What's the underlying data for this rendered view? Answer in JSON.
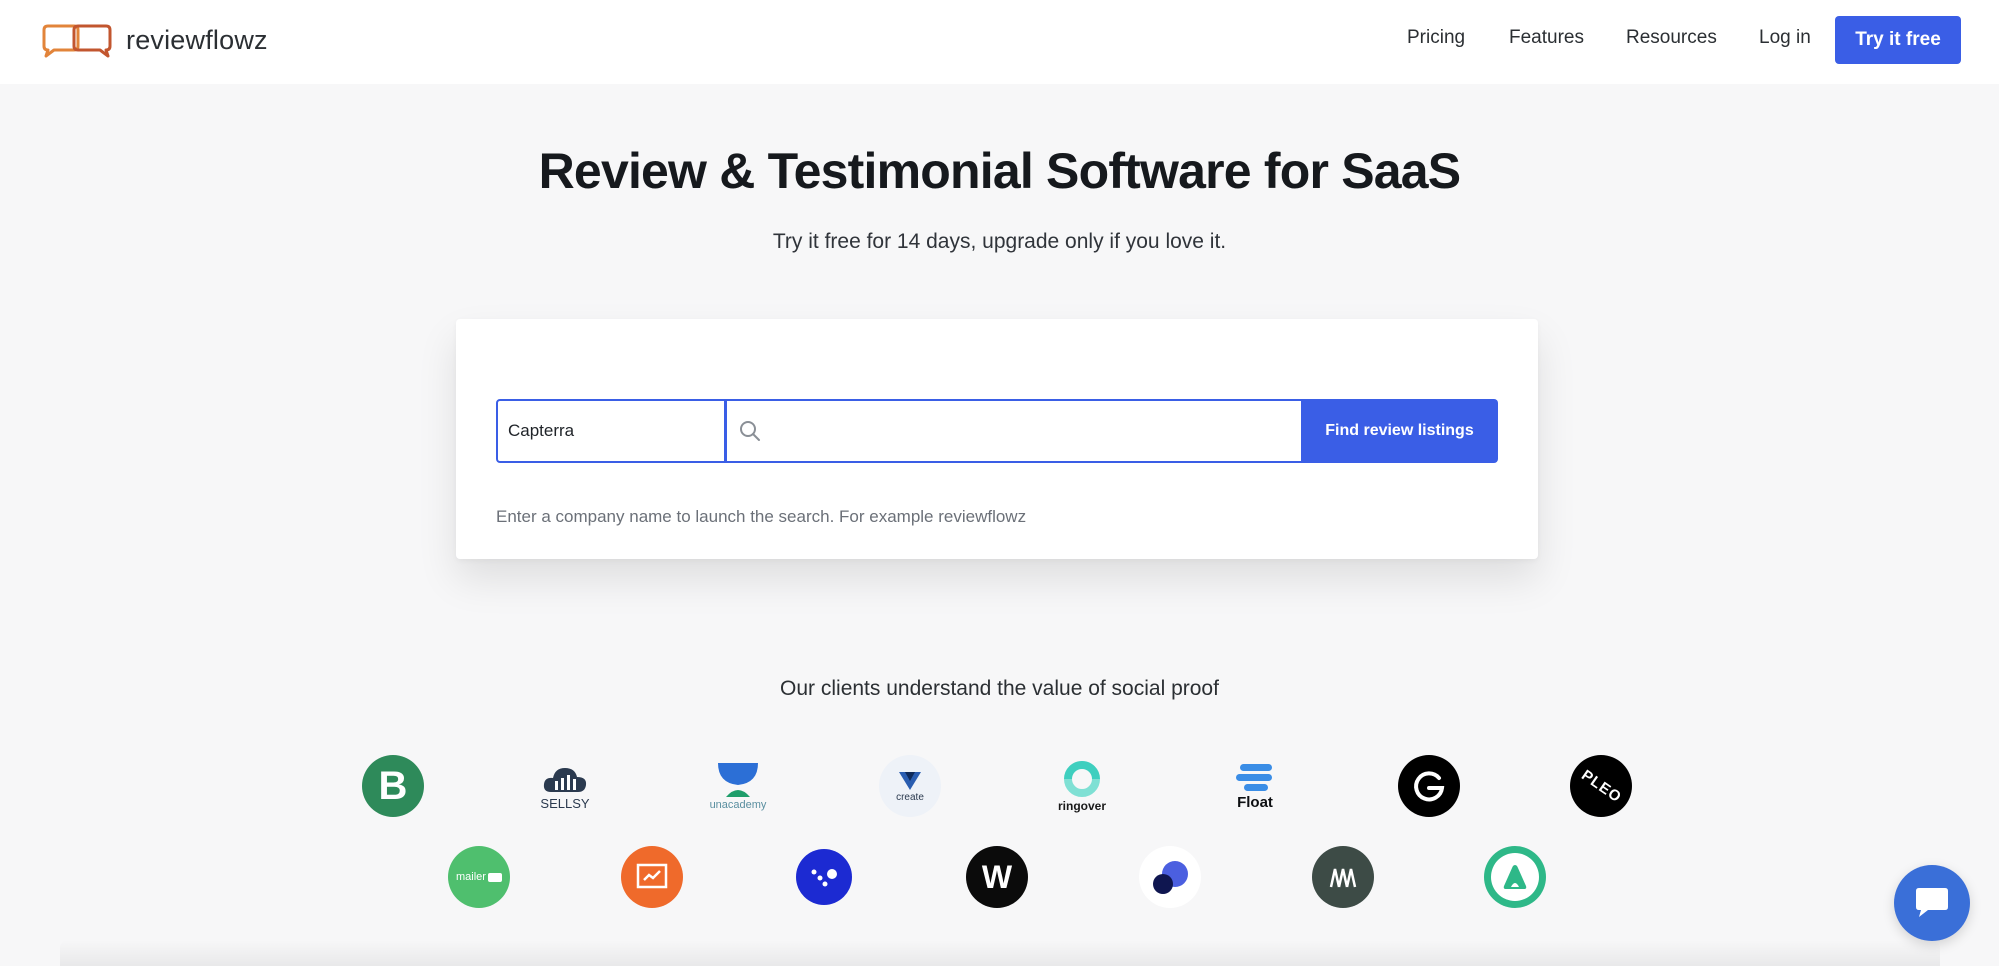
{
  "header": {
    "brand": "reviewflowz",
    "nav": [
      "Pricing",
      "Features",
      "Resources",
      "Log in"
    ],
    "cta_label": "Try it free",
    "accent": "#3a5ee6"
  },
  "hero": {
    "title": "Review & Testimonial Software for SaaS",
    "subtitle": "Try it free for 14 days, upgrade only if you love it."
  },
  "search": {
    "source_value": "Capterra",
    "query_value": "",
    "query_placeholder": "",
    "button_label": "Find review listings",
    "hint": "Enter a company name to launch the search. For example reviewflowz"
  },
  "clients": {
    "heading": "Our clients understand the value of social proof",
    "logos": [
      {
        "icon": "brevo-logo",
        "text": "B"
      },
      {
        "icon": "sellsy-logo",
        "text": "SELLSY"
      },
      {
        "icon": "unacademy-logo",
        "text": "unacademy"
      },
      {
        "icon": "create-logo",
        "text": "create"
      },
      {
        "icon": "ringover-logo",
        "text": "ringover"
      },
      {
        "icon": "float-logo",
        "text": "Float"
      },
      {
        "icon": "g-circle-logo",
        "text": ""
      },
      {
        "icon": "pleo-logo",
        "text": "PLEO"
      },
      {
        "icon": "mailerlite-logo",
        "text": "mailer"
      },
      {
        "icon": "chart-logo",
        "text": ""
      },
      {
        "icon": "dots-logo",
        "text": ""
      },
      {
        "icon": "w-logo",
        "text": "W"
      },
      {
        "icon": "blob-logo",
        "text": ""
      },
      {
        "icon": "m-logo",
        "text": ""
      },
      {
        "icon": "a-logo",
        "text": ""
      }
    ]
  },
  "chat": {
    "icon": "chat-bubble-icon"
  }
}
